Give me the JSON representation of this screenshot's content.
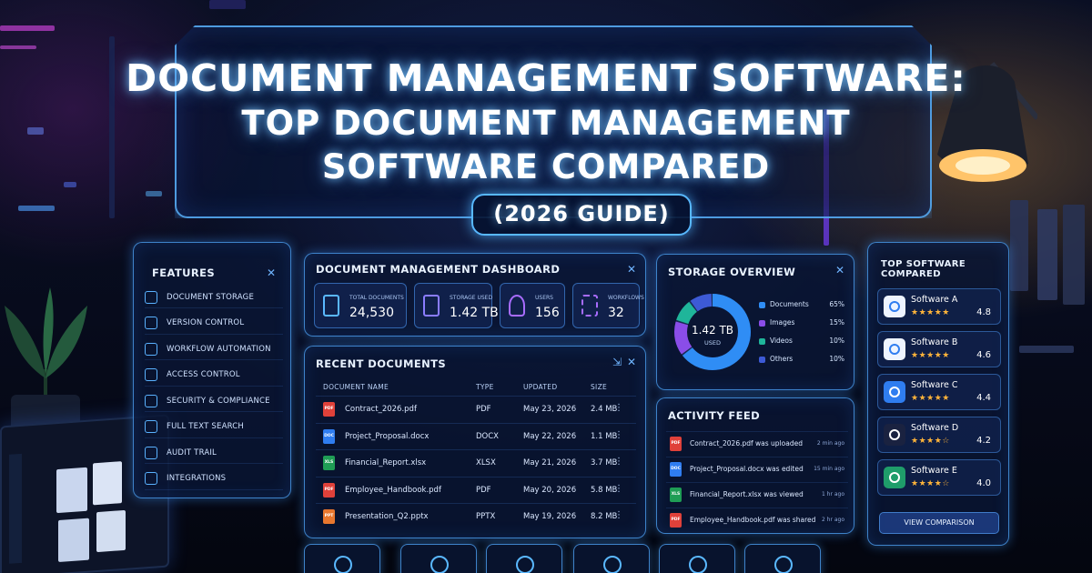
{
  "headline": {
    "line1": "DOCUMENT MANAGEMENT SOFTWARE:",
    "line2": "TOP DOCUMENT MANAGEMENT",
    "line3": "SOFTWARE COMPARED",
    "subtitle": "(2026 GUIDE)"
  },
  "features": {
    "title": "FEATURES",
    "items": [
      {
        "label": "DOCUMENT STORAGE",
        "icon": "folder-icon"
      },
      {
        "label": "VERSION CONTROL",
        "icon": "version-icon"
      },
      {
        "label": "WORKFLOW AUTOMATION",
        "icon": "workflow-icon"
      },
      {
        "label": "ACCESS CONTROL",
        "icon": "lock-icon"
      },
      {
        "label": "SECURITY & COMPLIANCE",
        "icon": "shield-icon"
      },
      {
        "label": "FULL TEXT SEARCH",
        "icon": "search-icon"
      },
      {
        "label": "AUDIT TRAIL",
        "icon": "audit-icon"
      },
      {
        "label": "INTEGRATIONS",
        "icon": "integrations-icon"
      }
    ]
  },
  "dashboard": {
    "title": "DOCUMENT MANAGEMENT DASHBOARD",
    "stats": [
      {
        "label": "TOTAL DOCUMENTS",
        "value": "24,530",
        "icon": "document-icon"
      },
      {
        "label": "STORAGE USED",
        "value": "1.42 TB",
        "icon": "storage-icon"
      },
      {
        "label": "USERS",
        "value": "156",
        "icon": "user-icon"
      },
      {
        "label": "WORKFLOWS",
        "value": "32",
        "icon": "workflow-icon"
      }
    ]
  },
  "recent": {
    "title": "RECENT DOCUMENTS",
    "columns": [
      "DOCUMENT NAME",
      "TYPE",
      "UPDATED",
      "SIZE"
    ],
    "rows": [
      {
        "name": "Contract_2026.pdf",
        "type": "PDF",
        "updated": "May 23, 2026",
        "size": "2.4 MB",
        "badge": "PDF",
        "color": "#e0413a"
      },
      {
        "name": "Project_Proposal.docx",
        "type": "DOCX",
        "updated": "May 22, 2026",
        "size": "1.1 MB",
        "badge": "DOC",
        "color": "#2f7df0"
      },
      {
        "name": "Financial_Report.xlsx",
        "type": "XLSX",
        "updated": "May 21, 2026",
        "size": "3.7 MB",
        "badge": "XLS",
        "color": "#1f9d55"
      },
      {
        "name": "Employee_Handbook.pdf",
        "type": "PDF",
        "updated": "May 20, 2026",
        "size": "5.8 MB",
        "badge": "PDF",
        "color": "#e0413a"
      },
      {
        "name": "Presentation_Q2.pptx",
        "type": "PPTX",
        "updated": "May 19, 2026",
        "size": "8.2 MB",
        "badge": "PPT",
        "color": "#e8772e"
      }
    ]
  },
  "storage": {
    "title": "STORAGE OVERVIEW",
    "center_value": "1.42 TB",
    "center_label": "USED",
    "segments": [
      {
        "name": "Documents",
        "pct": "65%",
        "value": 65,
        "color": "#2f8df5"
      },
      {
        "name": "Images",
        "pct": "15%",
        "value": 15,
        "color": "#8a4de8"
      },
      {
        "name": "Videos",
        "pct": "10%",
        "value": 10,
        "color": "#1fb59a"
      },
      {
        "name": "Others",
        "pct": "10%",
        "value": 10,
        "color": "#3d5ad6"
      }
    ]
  },
  "activity": {
    "title": "ACTIVITY FEED",
    "items": [
      {
        "text": "Contract_2026.pdf was uploaded",
        "time": "2 min ago",
        "badge": "PDF",
        "color": "#e0413a"
      },
      {
        "text": "Project_Proposal.docx was edited",
        "time": "15 min ago",
        "badge": "DOC",
        "color": "#2f7df0"
      },
      {
        "text": "Financial_Report.xlsx was viewed",
        "time": "1 hr ago",
        "badge": "XLS",
        "color": "#1f9d55"
      },
      {
        "text": "Employee_Handbook.pdf was shared",
        "time": "2 hr ago",
        "badge": "PDF",
        "color": "#e0413a"
      }
    ]
  },
  "top_software": {
    "title": "TOP SOFTWARE COMPARED",
    "items": [
      {
        "name": "Software A",
        "rating": "4.8",
        "stars": 4.8,
        "logo_bg": "#eef4ff"
      },
      {
        "name": "Software B",
        "rating": "4.6",
        "stars": 4.6,
        "logo_bg": "#eef4ff"
      },
      {
        "name": "Software C",
        "rating": "4.4",
        "stars": 4.4,
        "logo_bg": "#2f7df0"
      },
      {
        "name": "Software D",
        "rating": "4.2",
        "stars": 4.2,
        "logo_bg": "#1a2240"
      },
      {
        "name": "Software E",
        "rating": "4.0",
        "stars": 4.0,
        "logo_bg": "#1f9d6a"
      }
    ],
    "button": "VIEW COMPARISON"
  },
  "bottom_nav": [
    "cloud-icon",
    "inbox-icon",
    "search-icon",
    "shield-icon",
    "refresh-icon",
    "team-icon"
  ]
}
